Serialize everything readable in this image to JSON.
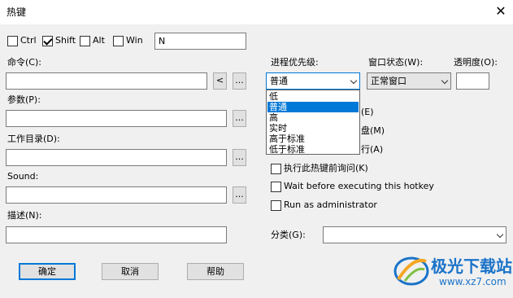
{
  "window": {
    "title": "热键",
    "close_glyph": "✕"
  },
  "modifiers": [
    {
      "label": "Ctrl",
      "checked": false
    },
    {
      "label": "Shift",
      "checked": true
    },
    {
      "label": "Alt",
      "checked": false
    },
    {
      "label": "Win",
      "checked": false
    }
  ],
  "key_value": "N",
  "command": {
    "label": "命令(C):",
    "value": "",
    "history_btn": "<",
    "browse_btn": "..."
  },
  "params": {
    "label": "参数(P):",
    "value": "",
    "browse_btn": "..."
  },
  "workdir": {
    "label": "工作目录(D):",
    "value": "",
    "browse_btn": "..."
  },
  "sound": {
    "label": "Sound:",
    "value": "",
    "browse_btn": "..."
  },
  "description": {
    "label": "描述(N):",
    "value": ""
  },
  "priority": {
    "label": "进程优先级:",
    "selected": "普通",
    "options": [
      "低",
      "普通",
      "高",
      "实时",
      "高于标准",
      "低于标准"
    ],
    "highlighted_index": 1
  },
  "window_state": {
    "label": "窗口状态(W):",
    "selected": "正常窗口"
  },
  "transparency": {
    "label": "透明度(O):",
    "value": ""
  },
  "options_partial": [
    {
      "label": "(E)",
      "checked": false
    },
    {
      "label": "盘(M)",
      "checked": false
    },
    {
      "label": "行(A)",
      "checked": false
    }
  ],
  "options": [
    {
      "label": "执行此热键前询问(K)",
      "checked": false
    },
    {
      "label": "Wait before executing this hotkey",
      "checked": false
    },
    {
      "label": "Run as administrator",
      "checked": false
    }
  ],
  "category": {
    "label": "分类(G):",
    "selected": ""
  },
  "buttons": {
    "ok": "确定",
    "cancel": "取消",
    "help": "帮助"
  },
  "watermark": {
    "brand": "极光下载站",
    "url": "www.xz7.com"
  },
  "colors": {
    "accent": "#0078d7",
    "background": "#f0f0f0",
    "watermark_blue": "#1a73c9"
  }
}
